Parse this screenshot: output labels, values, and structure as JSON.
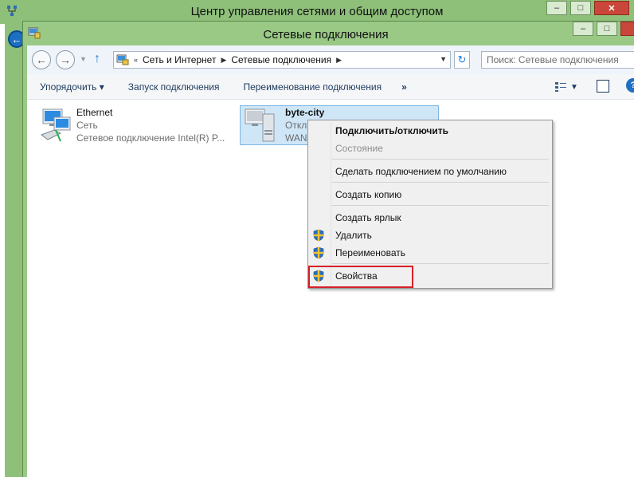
{
  "back_window": {
    "title": "Центр управления сетями и общим доступом"
  },
  "window": {
    "title": "Сетевые подключения"
  },
  "address": {
    "breadcrumbs": [
      "Сеть и Интернет",
      "Сетевые подключения"
    ],
    "search_placeholder": "Поиск: Сетевые подключения"
  },
  "commands": {
    "organize": "Упорядочить",
    "start": "Запуск подключения",
    "rename": "Переименование подключения",
    "more": "»"
  },
  "connections": [
    {
      "name": "Ethernet",
      "status": "Сеть",
      "device": "Сетевое подключение Intel(R) P..."
    },
    {
      "name": "byte-city",
      "status": "Откл",
      "device": "WAN"
    }
  ],
  "context_menu": {
    "items": [
      {
        "label": "Подключить/отключить",
        "bold": true
      },
      {
        "label": "Состояние",
        "disabled": true
      },
      {
        "label": "Сделать подключением по умолчанию"
      },
      {
        "label": "Создать копию"
      },
      {
        "label": "Создать ярлык"
      },
      {
        "label": "Удалить",
        "shield": true
      },
      {
        "label": "Переименовать",
        "shield": true
      },
      {
        "label": "Свойства",
        "shield": true
      }
    ]
  },
  "colors": {
    "aero_glass": "#99c985",
    "selection": "#cfe6f7",
    "highlight_box": "#d6202a"
  }
}
